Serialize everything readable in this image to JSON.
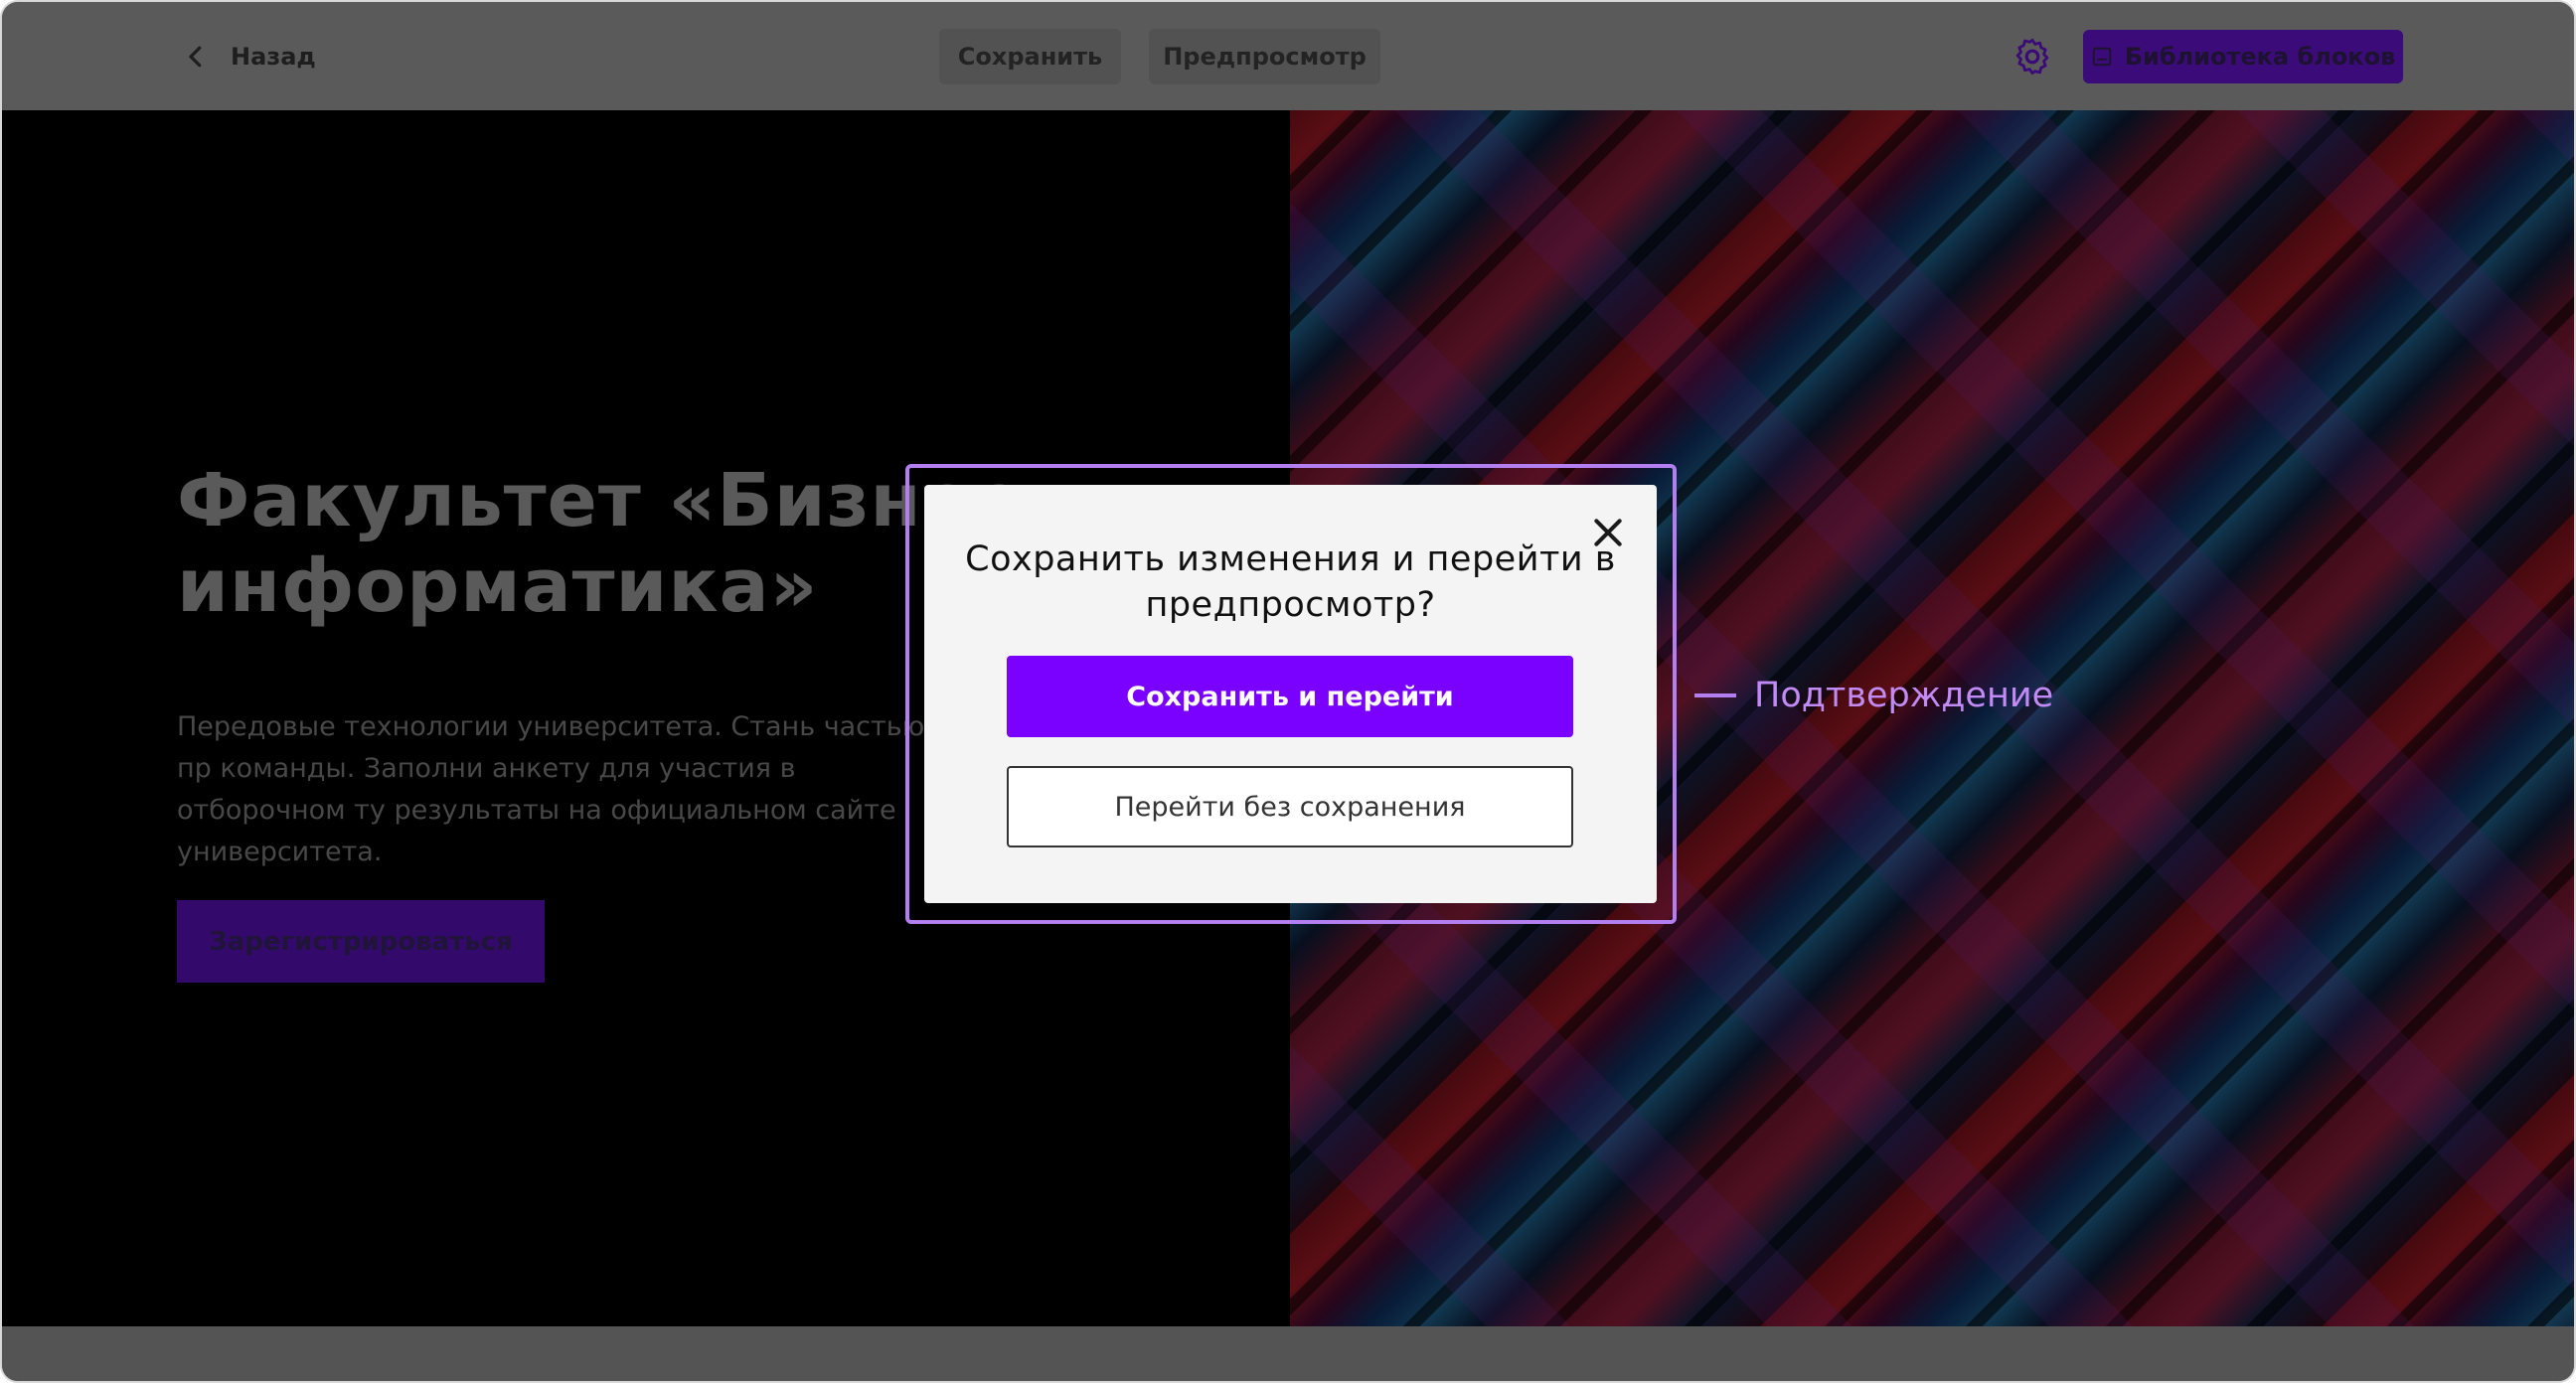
{
  "toolbar": {
    "back_label": "Назад",
    "save_label": "Сохранить",
    "preview_label": "Предпросмотр",
    "library_label": "Библиотека блоков"
  },
  "hero": {
    "title_line1": "Факультет «Бизнес",
    "title_line2": "информатика»",
    "text": "Передовые технологии университета. Стань частью пр команды. Заполни анкету для участия в отборочном ту результаты на официальном сайте университета.",
    "cta_label": "Зарегистрироваться"
  },
  "modal": {
    "title": "Сохранить изменения и перейти в предпросмотр?",
    "primary_label": "Сохранить и перейти",
    "secondary_label": "Перейти без сохранения"
  },
  "annotation": {
    "label": "Подтверждение"
  },
  "colors": {
    "accent": "#7a00ff",
    "annotation": "#b37ff0"
  },
  "icons": {
    "back": "chevron-left-icon",
    "settings": "gear-icon",
    "library": "block-library-icon",
    "close": "close-icon"
  }
}
